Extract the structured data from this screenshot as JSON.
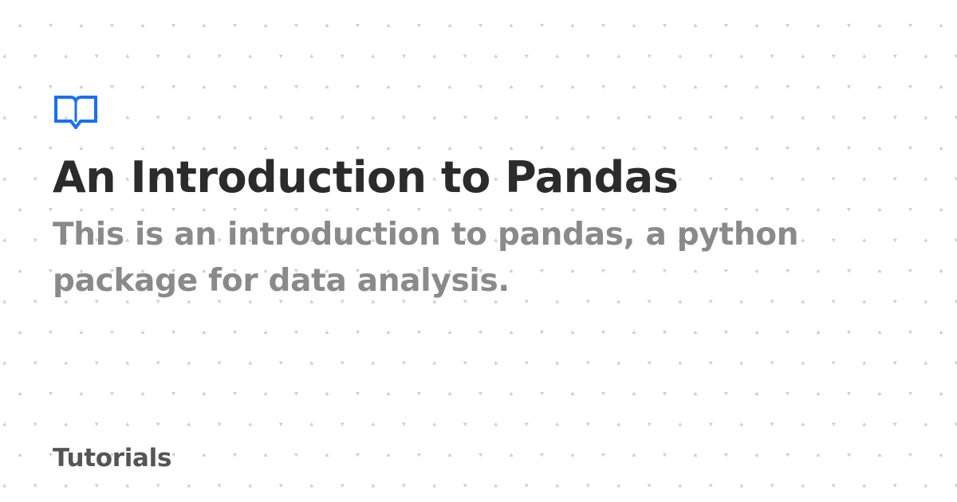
{
  "card": {
    "icon": "open-book-icon",
    "accent_color": "#1a6ff5",
    "title": "An Introduction to Pandas",
    "subtitle": "This is an introduction to pandas, a python package for data analysis.",
    "category": "Tutorials"
  }
}
